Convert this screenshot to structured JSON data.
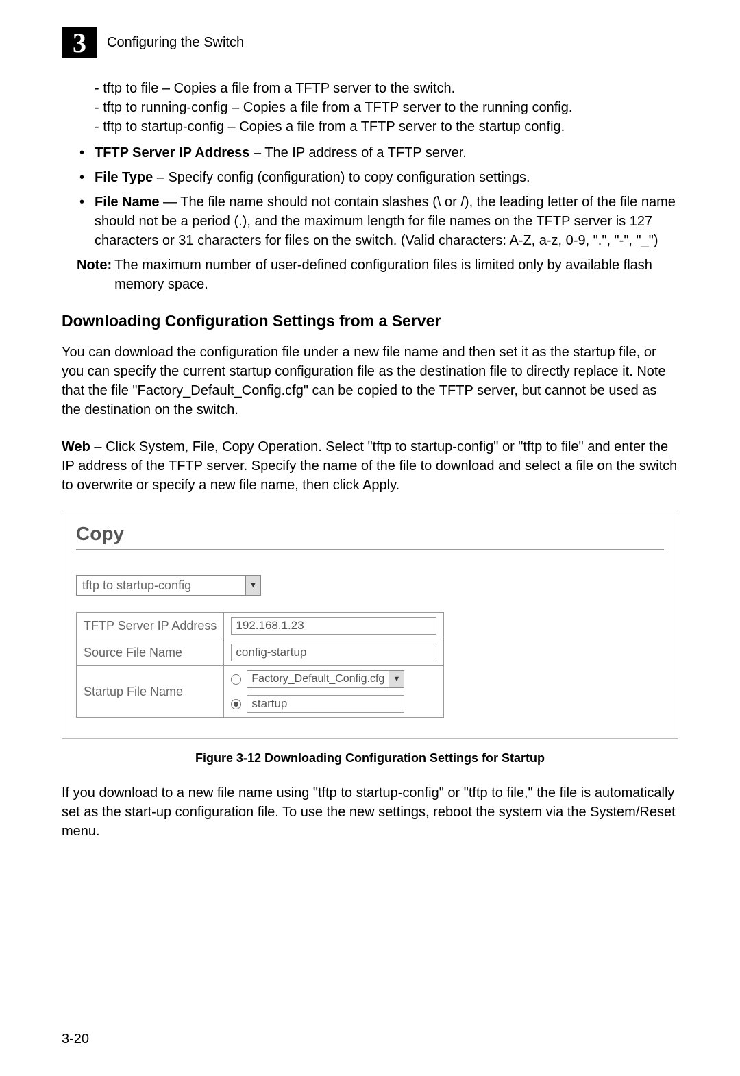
{
  "header": {
    "chapter_num": "3",
    "chapter_title": "Configuring the Switch"
  },
  "sublist": {
    "i0": "-  tftp to file – Copies a file from a TFTP server to the switch.",
    "i1": "-  tftp to running-config – Copies a file from a TFTP server to the running config.",
    "i2": "-  tftp to startup-config – Copies a file from a TFTP server to the startup config."
  },
  "bullets": {
    "b0_bold": "TFTP Server IP Address",
    "b0_rest": " – The IP address of a TFTP server.",
    "b1_bold": "File Type",
    "b1_rest": " – Specify config (configuration) to copy configuration settings.",
    "b2_bold": "File Name",
    "b2_rest": " — The file name should not contain slashes (\\ or /), the leading letter of the file name should not be a period (.), and the maximum length for file names on the TFTP server is 127 characters or 31 characters for files on the switch. (Valid characters: A-Z, a-z, 0-9, \".\", \"-\", \"_\")"
  },
  "note": {
    "label": "Note:",
    "text": " The maximum number of user-defined configuration files is limited only by available flash memory space."
  },
  "section": {
    "heading": "Downloading Configuration Settings from a Server",
    "p1": "You can download the configuration file under a new file name and then set it as the startup file, or you can specify the current startup configuration file as the destination file to directly replace it. Note that the file \"Factory_Default_Config.cfg\" can be copied to the TFTP server, but cannot be used as the destination on the switch.",
    "p2_bold": "Web",
    "p2_rest": " – Click System, File, Copy Operation. Select \"tftp to startup-config\" or \"tftp to file\" and enter the IP address of the TFTP server. Specify the name of the file to download and select a file on the switch to overwrite or specify a new file name, then click Apply."
  },
  "figure": {
    "title": "Copy",
    "select_value": "tftp to startup-config",
    "row1_label": "TFTP Server IP Address",
    "row1_value": "192.168.1.23",
    "row2_label": "Source File Name",
    "row2_value": "config-startup",
    "row3_label": "Startup File Name",
    "row3_opt1": "Factory_Default_Config.cfg",
    "row3_opt2": "startup",
    "caption": "Figure 3-12  Downloading Configuration Settings for Startup"
  },
  "after_fig": "If you download to a new file name using \"tftp to startup-config\" or \"tftp to file,\" the file is automatically set as the start-up configuration file. To use the new settings, reboot the system via the System/Reset menu.",
  "pagenum": "3-20"
}
